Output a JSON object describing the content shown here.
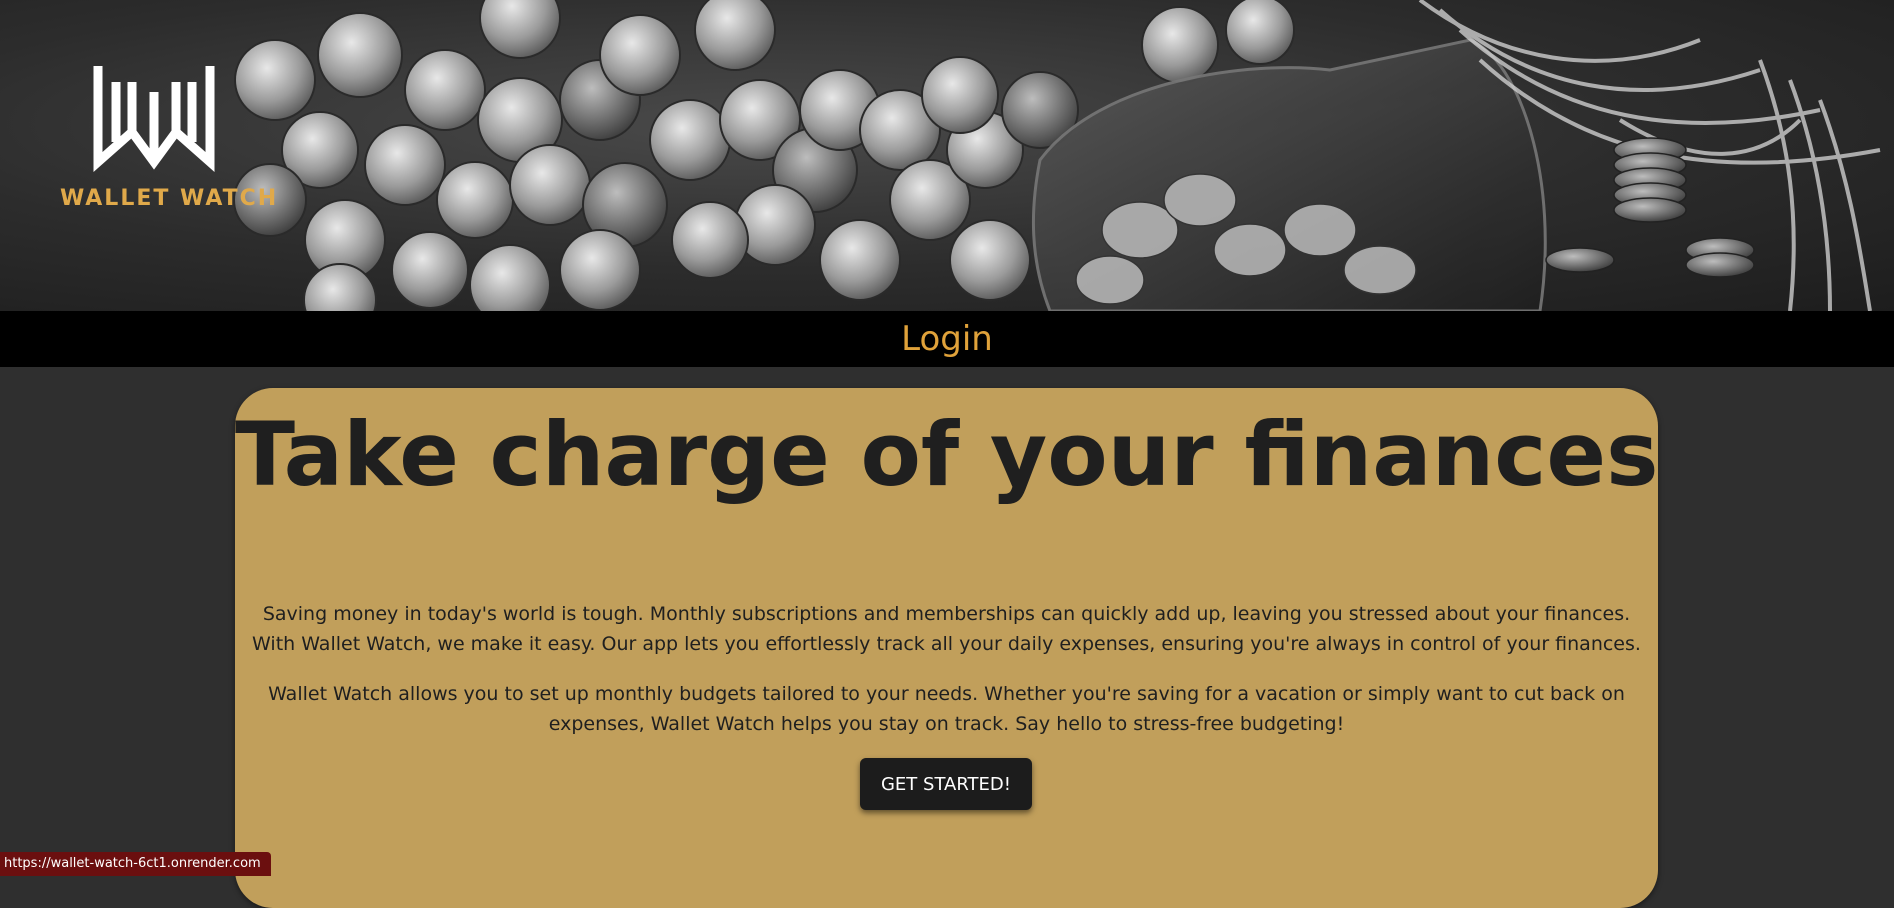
{
  "brand": {
    "name": "WALLET WATCH",
    "accent_color": "#e0a94a",
    "logo_icon": "ww-monogram-icon"
  },
  "hero": {
    "image": "coins-and-jar-photo-grayscale"
  },
  "nav": {
    "login_label": "Login",
    "link_color": "#e0a23a"
  },
  "main": {
    "headline": "Take charge of your finances",
    "paragraphs": [
      "Saving money in today's world is tough. Monthly subscriptions and memberships can quickly add up, leaving you stressed about your finances. With Wallet Watch, we make it easy. Our app lets you effortlessly track all your daily expenses, ensuring you're always in control of your finances.",
      "Wallet Watch allows you to set up monthly budgets tailored to your needs. Whether you're saving for a vacation or simply want to cut back on expenses, Wallet Watch helps you stay on track. Say hello to stress-free budgeting!"
    ],
    "cta_label": "GET STARTED!",
    "card_color": "#c19f5b"
  },
  "status_bar": {
    "url": "https://wallet-watch-6ct1.onrender.com"
  }
}
